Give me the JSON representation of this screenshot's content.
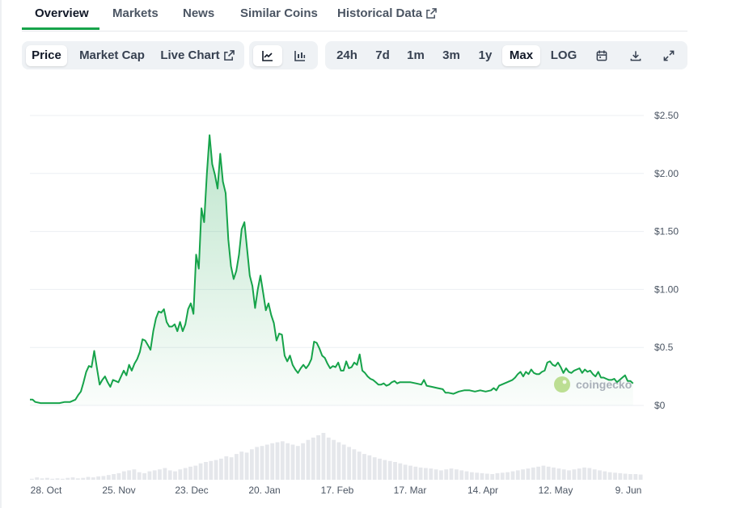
{
  "tabs": [
    {
      "label": "Overview"
    },
    {
      "label": "Markets"
    },
    {
      "label": "News"
    },
    {
      "label": "Similar Coins"
    },
    {
      "label": "Historical Data",
      "external": true
    }
  ],
  "toolbar": {
    "metric_buttons": [
      {
        "label": "Price",
        "active": true
      },
      {
        "label": "Market Cap"
      },
      {
        "label": "Live Chart",
        "external": true
      }
    ],
    "chart_type_buttons": [
      {
        "icon": "line-chart-icon",
        "active": true
      },
      {
        "icon": "candlestick-chart-icon"
      }
    ],
    "range_buttons": [
      {
        "label": "24h"
      },
      {
        "label": "7d"
      },
      {
        "label": "1m"
      },
      {
        "label": "3m"
      },
      {
        "label": "1y"
      },
      {
        "label": "Max",
        "active": true
      },
      {
        "label": "LOG"
      }
    ],
    "icon_buttons": [
      "calendar-icon",
      "download-icon",
      "expand-icon"
    ]
  },
  "watermark": "coingecko",
  "colors": {
    "line": "#16a34a",
    "accent": "#16a34a",
    "volume": "#e5e7eb"
  },
  "chart_data": {
    "type": "area",
    "x_tick_labels": [
      "28. Oct",
      "25. Nov",
      "23. Dec",
      "20. Jan",
      "17. Feb",
      "17. Mar",
      "14. Apr",
      "12. May",
      "9. Jun"
    ],
    "y_tick_labels": [
      "$0",
      "$0.5",
      "$1.00",
      "$1.50",
      "$2.00",
      "$2.50"
    ],
    "y_ticks": [
      0,
      0.5,
      1.0,
      1.5,
      2.0,
      2.5
    ],
    "ylim": [
      0,
      2.5
    ],
    "x_range_days": [
      0,
      229
    ],
    "grid": true,
    "series": [
      {
        "points": [
          [
            0,
            0.05
          ],
          [
            1,
            0.05
          ],
          [
            2,
            0.03
          ],
          [
            4,
            0.02
          ],
          [
            6,
            0.02
          ],
          [
            9,
            0.02
          ],
          [
            11,
            0.02
          ],
          [
            13,
            0.03
          ],
          [
            15,
            0.03
          ],
          [
            17,
            0.05
          ],
          [
            18,
            0.09
          ],
          [
            19,
            0.12
          ],
          [
            20,
            0.2
          ],
          [
            21,
            0.29
          ],
          [
            22,
            0.34
          ],
          [
            23,
            0.33
          ],
          [
            24,
            0.47
          ],
          [
            25,
            0.32
          ],
          [
            26,
            0.18
          ],
          [
            27,
            0.22
          ],
          [
            28,
            0.25
          ],
          [
            29,
            0.2
          ],
          [
            30,
            0.16
          ],
          [
            31,
            0.22
          ],
          [
            32,
            0.21
          ],
          [
            33,
            0.2
          ],
          [
            34,
            0.25
          ],
          [
            35,
            0.3
          ],
          [
            36,
            0.26
          ],
          [
            37,
            0.35
          ],
          [
            38,
            0.3
          ],
          [
            39,
            0.36
          ],
          [
            40,
            0.4
          ],
          [
            41,
            0.46
          ],
          [
            42,
            0.57
          ],
          [
            43,
            0.56
          ],
          [
            44,
            0.52
          ],
          [
            45,
            0.48
          ],
          [
            46,
            0.64
          ],
          [
            47,
            0.75
          ],
          [
            48,
            0.81
          ],
          [
            49,
            0.8
          ],
          [
            50,
            0.83
          ],
          [
            51,
            0.72
          ],
          [
            52,
            0.68
          ],
          [
            53,
            0.68
          ],
          [
            54,
            0.7
          ],
          [
            55,
            0.64
          ],
          [
            56,
            0.72
          ],
          [
            57,
            0.64
          ],
          [
            58,
            0.7
          ],
          [
            59,
            0.83
          ],
          [
            60,
            0.88
          ],
          [
            61,
            0.79
          ],
          [
            62,
            1.3
          ],
          [
            63,
            1.18
          ],
          [
            64,
            1.7
          ],
          [
            65,
            1.58
          ],
          [
            66,
            2.0
          ],
          [
            67,
            2.33
          ],
          [
            68,
            2.08
          ],
          [
            69,
            1.99
          ],
          [
            70,
            1.87
          ],
          [
            71,
            2.17
          ],
          [
            72,
            1.93
          ],
          [
            73,
            1.83
          ],
          [
            74,
            1.43
          ],
          [
            75,
            1.2
          ],
          [
            76,
            1.09
          ],
          [
            77,
            1.16
          ],
          [
            78,
            1.3
          ],
          [
            79,
            1.52
          ],
          [
            80,
            1.58
          ],
          [
            81,
            1.35
          ],
          [
            82,
            1.12
          ],
          [
            83,
            1.03
          ],
          [
            84,
            0.84
          ],
          [
            85,
            1.0
          ],
          [
            86,
            1.12
          ],
          [
            87,
            0.97
          ],
          [
            88,
            0.82
          ],
          [
            89,
            0.88
          ],
          [
            90,
            0.78
          ],
          [
            91,
            0.71
          ],
          [
            92,
            0.56
          ],
          [
            93,
            0.62
          ],
          [
            94,
            0.61
          ],
          [
            95,
            0.43
          ],
          [
            96,
            0.38
          ],
          [
            97,
            0.43
          ],
          [
            98,
            0.35
          ],
          [
            99,
            0.31
          ],
          [
            100,
            0.28
          ],
          [
            101,
            0.32
          ],
          [
            102,
            0.35
          ],
          [
            103,
            0.32
          ],
          [
            104,
            0.35
          ],
          [
            105,
            0.4
          ],
          [
            106,
            0.55
          ],
          [
            107,
            0.54
          ],
          [
            108,
            0.49
          ],
          [
            109,
            0.43
          ],
          [
            110,
            0.41
          ],
          [
            111,
            0.36
          ],
          [
            112,
            0.32
          ],
          [
            113,
            0.34
          ],
          [
            114,
            0.33
          ],
          [
            115,
            0.37
          ],
          [
            116,
            0.3
          ],
          [
            117,
            0.3
          ],
          [
            118,
            0.38
          ],
          [
            119,
            0.32
          ],
          [
            120,
            0.33
          ],
          [
            121,
            0.37
          ],
          [
            122,
            0.35
          ],
          [
            123,
            0.44
          ],
          [
            124,
            0.3
          ],
          [
            125,
            0.28
          ],
          [
            126,
            0.25
          ],
          [
            127,
            0.23
          ],
          [
            128,
            0.22
          ],
          [
            129,
            0.2
          ],
          [
            130,
            0.18
          ],
          [
            131,
            0.18
          ],
          [
            132,
            0.19
          ],
          [
            133,
            0.17
          ],
          [
            134,
            0.18
          ],
          [
            135,
            0.2
          ],
          [
            136,
            0.21
          ],
          [
            137,
            0.19
          ],
          [
            138,
            0.2
          ],
          [
            140,
            0.2
          ],
          [
            142,
            0.2
          ],
          [
            144,
            0.19
          ],
          [
            146,
            0.18
          ],
          [
            147,
            0.22
          ],
          [
            148,
            0.17
          ],
          [
            150,
            0.16
          ],
          [
            152,
            0.15
          ],
          [
            154,
            0.14
          ],
          [
            155,
            0.11
          ],
          [
            156,
            0.11
          ],
          [
            158,
            0.1
          ],
          [
            160,
            0.12
          ],
          [
            162,
            0.13
          ],
          [
            164,
            0.13
          ],
          [
            166,
            0.12
          ],
          [
            168,
            0.13
          ],
          [
            170,
            0.12
          ],
          [
            172,
            0.13
          ],
          [
            173,
            0.15
          ],
          [
            174,
            0.13
          ],
          [
            175,
            0.17
          ],
          [
            176,
            0.18
          ],
          [
            178,
            0.2
          ],
          [
            180,
            0.22
          ],
          [
            181,
            0.24
          ],
          [
            182,
            0.27
          ],
          [
            183,
            0.29
          ],
          [
            184,
            0.25
          ],
          [
            185,
            0.29
          ],
          [
            186,
            0.27
          ],
          [
            187,
            0.31
          ],
          [
            188,
            0.28
          ],
          [
            189,
            0.27
          ],
          [
            190,
            0.27
          ],
          [
            191,
            0.29
          ],
          [
            192,
            0.3
          ],
          [
            193,
            0.37
          ],
          [
            194,
            0.38
          ],
          [
            195,
            0.35
          ],
          [
            196,
            0.34
          ],
          [
            197,
            0.37
          ],
          [
            198,
            0.33
          ],
          [
            199,
            0.28
          ],
          [
            200,
            0.32
          ],
          [
            201,
            0.29
          ],
          [
            202,
            0.28
          ],
          [
            203,
            0.3
          ],
          [
            204,
            0.31
          ],
          [
            205,
            0.32
          ],
          [
            206,
            0.28
          ],
          [
            207,
            0.31
          ],
          [
            208,
            0.29
          ],
          [
            209,
            0.3
          ],
          [
            210,
            0.27
          ],
          [
            211,
            0.25
          ],
          [
            212,
            0.29
          ],
          [
            213,
            0.24
          ],
          [
            214,
            0.24
          ],
          [
            215,
            0.23
          ],
          [
            216,
            0.22
          ],
          [
            217,
            0.22
          ],
          [
            218,
            0.23
          ],
          [
            219,
            0.2
          ],
          [
            220,
            0.22
          ],
          [
            221,
            0.24
          ],
          [
            222,
            0.26
          ],
          [
            223,
            0.21
          ],
          [
            224,
            0.21
          ],
          [
            225,
            0.19
          ]
        ]
      }
    ],
    "volume": [
      0.02,
      0.05,
      0.03,
      0.04,
      0.02,
      0.03,
      0.02,
      0.04,
      0.05,
      0.03,
      0.04,
      0.06,
      0.05,
      0.07,
      0.08,
      0.1,
      0.12,
      0.14,
      0.18,
      0.2,
      0.22,
      0.16,
      0.14,
      0.18,
      0.2,
      0.22,
      0.25,
      0.2,
      0.18,
      0.22,
      0.25,
      0.28,
      0.3,
      0.35,
      0.38,
      0.4,
      0.42,
      0.45,
      0.5,
      0.48,
      0.55,
      0.6,
      0.58,
      0.65,
      0.7,
      0.72,
      0.75,
      0.78,
      0.8,
      0.82,
      0.78,
      0.75,
      0.72,
      0.78,
      0.85,
      0.9,
      0.95,
      1.0,
      0.9,
      0.85,
      0.8,
      0.75,
      0.7,
      0.65,
      0.6,
      0.55,
      0.52,
      0.48,
      0.45,
      0.42,
      0.4,
      0.38,
      0.35,
      0.32,
      0.3,
      0.28,
      0.26,
      0.25,
      0.24,
      0.22,
      0.2,
      0.22,
      0.24,
      0.22,
      0.2,
      0.18,
      0.16,
      0.15,
      0.14,
      0.13,
      0.12,
      0.14,
      0.15,
      0.16,
      0.18,
      0.2,
      0.22,
      0.24,
      0.26,
      0.28,
      0.3,
      0.28,
      0.26,
      0.24,
      0.22,
      0.2,
      0.22,
      0.24,
      0.26,
      0.25,
      0.22,
      0.2,
      0.18,
      0.16,
      0.15,
      0.14,
      0.13,
      0.12,
      0.12,
      0.11
    ]
  }
}
